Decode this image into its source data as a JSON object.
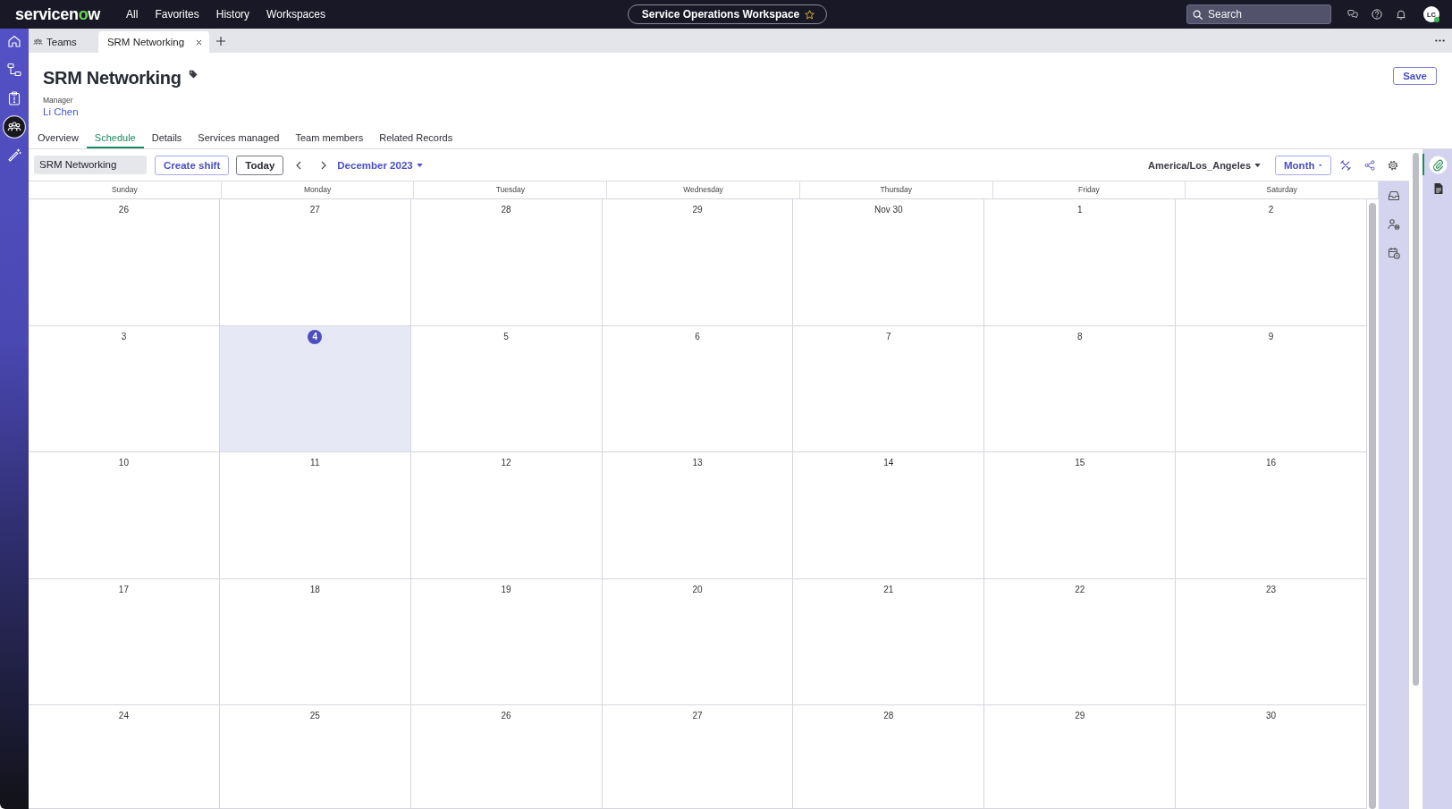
{
  "top_bar": {
    "logo": "servicenow",
    "nav": [
      "All",
      "Favorites",
      "History",
      "Workspaces"
    ],
    "workspace": "Service Operations Workspace",
    "search": {
      "placeholder": "Search"
    },
    "avatar": {
      "initials": "LC",
      "online": true
    }
  },
  "left_rail": [
    {
      "kind": "home",
      "selected": false
    },
    {
      "kind": "hierarchy",
      "selected": false
    },
    {
      "kind": "clipboard",
      "selected": false
    },
    {
      "kind": "team",
      "selected": true
    },
    {
      "kind": "wand",
      "selected": false
    }
  ],
  "tab_bar": [
    {
      "kind": "list",
      "label": "Teams",
      "selected": false,
      "closable": false
    },
    {
      "kind": "record",
      "label": "SRM Networking",
      "selected": true,
      "closable": true
    }
  ],
  "record": {
    "title": "SRM Networking",
    "manager_label": "Manager",
    "manager": "Li Chen",
    "save_button": "Save"
  },
  "tabs": [
    {
      "label": "Overview",
      "selected": false
    },
    {
      "label": "Schedule",
      "selected": true
    },
    {
      "label": "Details",
      "selected": false
    },
    {
      "label": "Services managed",
      "selected": false
    },
    {
      "label": "Team members",
      "selected": false
    },
    {
      "label": "Related Records",
      "selected": false
    }
  ],
  "toolbar": {
    "group_field": "SRM Networking",
    "create_button": "Create shift",
    "today_button": "Today",
    "period": "December 2023",
    "timezone": "America/Los_Angeles",
    "view": "Month"
  },
  "calendar": {
    "weekdays": [
      "Sunday",
      "Monday",
      "Tuesday",
      "Wednesday",
      "Thursday",
      "Friday",
      "Saturday"
    ],
    "weeks": [
      [
        {
          "label": "26",
          "today": false
        },
        {
          "label": "27",
          "today": false
        },
        {
          "label": "28",
          "today": false
        },
        {
          "label": "29",
          "today": false
        },
        {
          "label": "Nov 30",
          "today": false
        },
        {
          "label": "1",
          "today": false
        },
        {
          "label": "2",
          "today": false
        }
      ],
      [
        {
          "label": "3",
          "today": false
        },
        {
          "label": "4",
          "today": true
        },
        {
          "label": "5",
          "today": false
        },
        {
          "label": "6",
          "today": false
        },
        {
          "label": "7",
          "today": false
        },
        {
          "label": "8",
          "today": false
        },
        {
          "label": "9",
          "today": false
        }
      ],
      [
        {
          "label": "10",
          "today": false
        },
        {
          "label": "11",
          "today": false
        },
        {
          "label": "12",
          "today": false
        },
        {
          "label": "13",
          "today": false
        },
        {
          "label": "14",
          "today": false
        },
        {
          "label": "15",
          "today": false
        },
        {
          "label": "16",
          "today": false
        }
      ],
      [
        {
          "label": "17",
          "today": false
        },
        {
          "label": "18",
          "today": false
        },
        {
          "label": "19",
          "today": false
        },
        {
          "label": "20",
          "today": false
        },
        {
          "label": "21",
          "today": false
        },
        {
          "label": "22",
          "today": false
        },
        {
          "label": "23",
          "today": false
        }
      ],
      [
        {
          "label": "24",
          "today": false
        },
        {
          "label": "25",
          "today": false
        },
        {
          "label": "26",
          "today": false
        },
        {
          "label": "27",
          "today": false
        },
        {
          "label": "28",
          "today": false
        },
        {
          "label": "29",
          "today": false
        },
        {
          "label": "30",
          "today": false
        }
      ]
    ]
  },
  "right_rail": [
    {
      "kind": "attachment",
      "selected": true
    },
    {
      "kind": "document",
      "selected": false
    }
  ]
}
